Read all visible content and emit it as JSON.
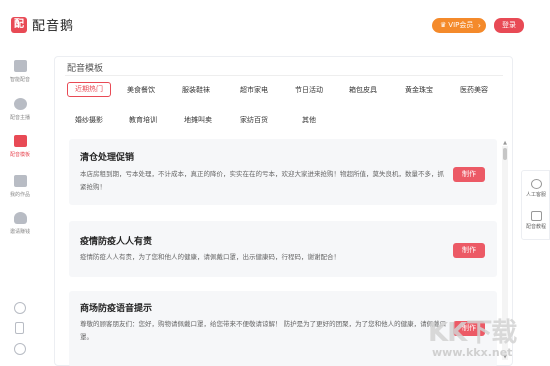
{
  "app": {
    "logo_glyph": "配",
    "title": "配音鹅",
    "vip_label": "VIP会员",
    "login_label": "登录",
    "accent_color": "#e84a55",
    "vip_color": "#f48a2b"
  },
  "sidebar": {
    "items": [
      {
        "label": "智能配音",
        "icon": "speaker-icon"
      },
      {
        "label": "配音主播",
        "icon": "anchor-icon"
      },
      {
        "label": "配音模板",
        "icon": "template-icon"
      },
      {
        "label": "我的作品",
        "icon": "folder-icon"
      },
      {
        "label": "邀请赚钱",
        "icon": "money-bag-icon"
      }
    ],
    "active_index": 2
  },
  "main": {
    "section_title": "配音模板",
    "categories": [
      "近期热门",
      "美食餐饮",
      "服装鞋袜",
      "超市家电",
      "节日活动",
      "箱包皮具",
      "黄金珠宝",
      "医药美容",
      "婚纱摄影",
      "教育培训",
      "地摊叫卖",
      "家纺百货",
      "其他"
    ],
    "active_category_index": 0,
    "make_label": "制作",
    "cards": [
      {
        "title": "清仓处理促销",
        "desc": "本店房租到期，亏本处理，不计成本，真正的降价，实实在在的亏本，欢迎大家进来抢购！物超所值，莫失良机，数量不多，抓紧抢购！"
      },
      {
        "title": "疫情防疫人人有责",
        "desc": "疫情防疫人人有责，为了您和他人的健康，请佩戴口罩，出示健康码，行程码，谢谢配合！"
      },
      {
        "title": "商场防疫语音提示",
        "desc": "尊敬的顾客朋友们：您好，购物请佩戴口罩，给您带来不便敬请谅解！ 防护是为了更好的团聚，为了您和他人的健康，请佩戴口罩。"
      }
    ]
  },
  "right_panel": {
    "items": [
      {
        "label": "人工客服",
        "icon": "headset-icon"
      },
      {
        "label": "配音教程",
        "icon": "tutorial-icon"
      }
    ]
  },
  "watermark": {
    "mark": "KK下载",
    "url": "www.kkx.net"
  }
}
